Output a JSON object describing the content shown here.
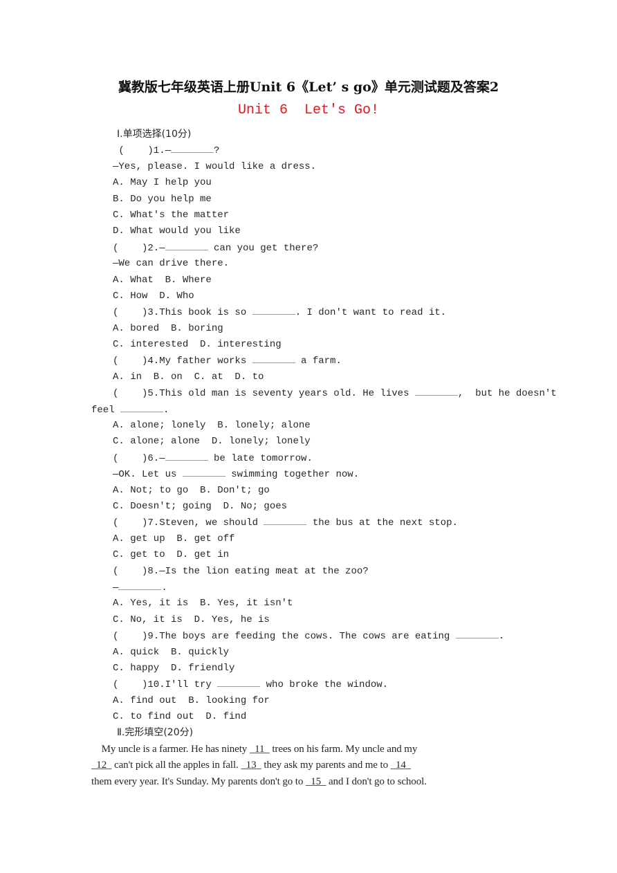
{
  "header": {
    "title": "冀教版七年级英语上册Unit 6《Let’ s go》单元测试题及答案2",
    "subtitle": "Unit 6  Let's Go!",
    "subtitle_color": "#e8141c"
  },
  "section1": {
    "heading": "Ⅰ.单项选择(10分)",
    "questions": [
      {
        "stem_prefix": " (    )1.—",
        "stem_suffix": "?",
        "reply": "—Yes, please. I would like a dress.",
        "options": [
          "A. May I help you",
          "B. Do you help me",
          "C. What's the matter",
          "D. What would you like"
        ]
      },
      {
        "stem_prefix": "(    )2.—",
        "stem_suffix": " can you get there?",
        "reply": "—We can drive there.",
        "options": [
          "A. What  B. Where",
          "C. How  D. Who"
        ]
      },
      {
        "stem_prefix": "(    )3.This book is so ",
        "stem_suffix": ". I don't want to read it.",
        "options": [
          "A. bored  B. boring",
          "C. interested  D. interesting"
        ]
      },
      {
        "stem_prefix": "(    )4.My father works ",
        "stem_suffix": " a farm.",
        "options": [
          "A. in  B. on  C. at  D. to"
        ]
      },
      {
        "stem_prefix": "(    )5.This old man is seventy years old. He lives ",
        "stem_mid": ",  but he doesn't",
        "stem_cont_prefix": "feel ",
        "stem_suffix": ".",
        "options": [
          "A. alone; lonely  B. lonely; alone",
          "C. alone; alone  D. lonely; lonely"
        ]
      },
      {
        "stem_prefix": "(    )6.—",
        "stem_suffix": " be late tomorrow.",
        "reply_prefix": "—OK. Let us ",
        "reply_suffix": " swimming together now.",
        "options": [
          "A. Not; to go  B. Don't; go",
          "C. Doesn't; going  D. No; goes"
        ]
      },
      {
        "stem_prefix": "(    )7.Steven, we should ",
        "stem_suffix": " the bus at the next stop.",
        "options": [
          "A. get up  B. get off",
          "C. get to  D. get in"
        ]
      },
      {
        "stem_prefix": "(    )8.—Is the lion eating meat at the zoo?",
        "reply_prefix": "—",
        "reply_suffix": ".",
        "options": [
          "A. Yes, it is  B. Yes, it isn't",
          "C. No, it is  D. Yes, he is"
        ]
      },
      {
        "stem_prefix": "(    )9.The boys are feeding the cows. The cows are eating ",
        "stem_suffix": ".",
        "options": [
          "A. quick  B. quickly",
          "C. happy  D. friendly"
        ]
      },
      {
        "stem_prefix": "(    )10.I'll try ",
        "stem_suffix": " who broke the window.",
        "options": [
          "A. find out  B. looking for",
          "C. to find out  D. find"
        ]
      }
    ]
  },
  "section2": {
    "heading": "Ⅱ.完形填空(20分)",
    "passage": {
      "line1_a": "    My uncle is a farmer. He has ninety ",
      "blank11": "  11  ",
      "line1_b": " trees on his farm. My uncle and my",
      "blank12": "  12  ",
      "line2_a": " can't pick all the apples in fall. ",
      "blank13": "  13  ",
      "line2_b": " they ask my parents and me to ",
      "blank14": "  14  ",
      "line3_a": "them every year. It's Sunday. My parents don't go to ",
      "blank15": "  15  ",
      "line3_b": " and I don't go to school."
    }
  }
}
